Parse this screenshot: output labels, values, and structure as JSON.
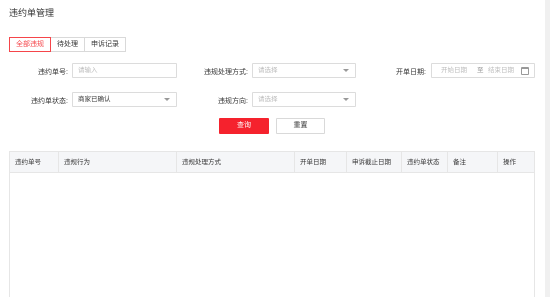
{
  "page": {
    "title": "违约单管理"
  },
  "tabs": [
    {
      "label": "全部违规",
      "active": true
    },
    {
      "label": "待处理",
      "active": false
    },
    {
      "label": "申诉记录",
      "active": false
    }
  ],
  "filters": {
    "violation_no": {
      "label": "违约单号:",
      "placeholder": "请输入"
    },
    "handling_method": {
      "label": "违规处理方式:",
      "placeholder": "请选择"
    },
    "open_date": {
      "label": "开单日期:",
      "start_placeholder": "开始日期",
      "separator": "至",
      "end_placeholder": "结束日期"
    },
    "status": {
      "label": "违约单状态:",
      "value": "商家已确认"
    },
    "direction": {
      "label": "违规方向:",
      "placeholder": "请选择"
    }
  },
  "buttons": {
    "query": "查询",
    "reset": "重置"
  },
  "table": {
    "columns": [
      "违约单号",
      "违规行为",
      "违规处理方式",
      "开单日期",
      "申诉截止日期",
      "违约单状态",
      "备注",
      "操作"
    ],
    "rows": []
  },
  "colors": {
    "accent": "#f5222d",
    "header_bg": "#f5f6f8"
  }
}
